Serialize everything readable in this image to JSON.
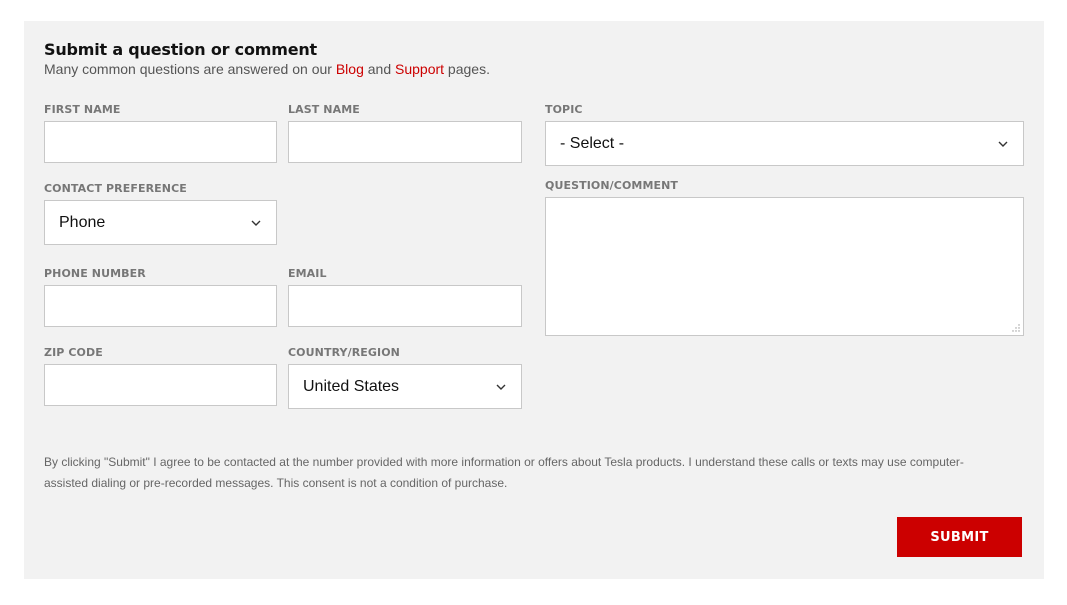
{
  "form": {
    "title": "Submit a question or comment",
    "subtitle_prefix": "Many common questions are answered on our ",
    "blog_link": "Blog",
    "subtitle_and": " and ",
    "support_link": "Support",
    "subtitle_suffix": " pages.",
    "fields": {
      "first_name_label": "FIRST NAME",
      "first_name_value": "",
      "last_name_label": "LAST NAME",
      "last_name_value": "",
      "topic_label": "TOPIC",
      "topic_value": "- Select -",
      "contact_pref_label": "CONTACT PREFERENCE",
      "contact_pref_value": "Phone",
      "question_label": "QUESTION/COMMENT",
      "question_value": "",
      "phone_label": "PHONE NUMBER",
      "phone_value": "",
      "email_label": "EMAIL",
      "email_value": "",
      "zip_label": "ZIP CODE",
      "zip_value": "",
      "country_label": "COUNTRY/REGION",
      "country_value": "United States"
    },
    "disclaimer": "By clicking \"Submit\" I agree to be contacted at the number provided with more information or offers about Tesla products. I understand these calls or texts may use computer-assisted dialing or pre-recorded messages. This consent is not a condition of purchase.",
    "submit_label": "SUBMIT"
  },
  "colors": {
    "accent": "#cc0000",
    "panel_bg": "#f2f2f2",
    "label": "#777777"
  },
  "icons": {
    "select_arrow": "chevron-down-icon",
    "textarea_resize": "resize-grip-icon"
  }
}
